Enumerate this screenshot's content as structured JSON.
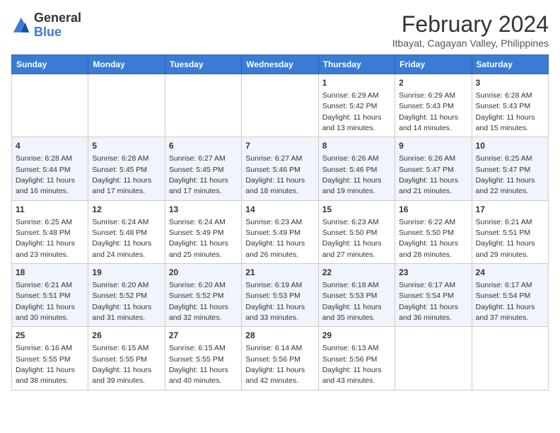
{
  "logo": {
    "general": "General",
    "blue": "Blue"
  },
  "title": "February 2024",
  "location": "Itbayat, Cagayan Valley, Philippines",
  "days_of_week": [
    "Sunday",
    "Monday",
    "Tuesday",
    "Wednesday",
    "Thursday",
    "Friday",
    "Saturday"
  ],
  "weeks": [
    [
      {
        "day": "",
        "sunrise": "",
        "sunset": "",
        "daylight": ""
      },
      {
        "day": "",
        "sunrise": "",
        "sunset": "",
        "daylight": ""
      },
      {
        "day": "",
        "sunrise": "",
        "sunset": "",
        "daylight": ""
      },
      {
        "day": "",
        "sunrise": "",
        "sunset": "",
        "daylight": ""
      },
      {
        "day": "1",
        "sunrise": "Sunrise: 6:29 AM",
        "sunset": "Sunset: 5:42 PM",
        "daylight": "Daylight: 11 hours and 13 minutes."
      },
      {
        "day": "2",
        "sunrise": "Sunrise: 6:29 AM",
        "sunset": "Sunset: 5:43 PM",
        "daylight": "Daylight: 11 hours and 14 minutes."
      },
      {
        "day": "3",
        "sunrise": "Sunrise: 6:28 AM",
        "sunset": "Sunset: 5:43 PM",
        "daylight": "Daylight: 11 hours and 15 minutes."
      }
    ],
    [
      {
        "day": "4",
        "sunrise": "Sunrise: 6:28 AM",
        "sunset": "Sunset: 5:44 PM",
        "daylight": "Daylight: 11 hours and 16 minutes."
      },
      {
        "day": "5",
        "sunrise": "Sunrise: 6:28 AM",
        "sunset": "Sunset: 5:45 PM",
        "daylight": "Daylight: 11 hours and 17 minutes."
      },
      {
        "day": "6",
        "sunrise": "Sunrise: 6:27 AM",
        "sunset": "Sunset: 5:45 PM",
        "daylight": "Daylight: 11 hours and 17 minutes."
      },
      {
        "day": "7",
        "sunrise": "Sunrise: 6:27 AM",
        "sunset": "Sunset: 5:46 PM",
        "daylight": "Daylight: 11 hours and 18 minutes."
      },
      {
        "day": "8",
        "sunrise": "Sunrise: 6:26 AM",
        "sunset": "Sunset: 5:46 PM",
        "daylight": "Daylight: 11 hours and 19 minutes."
      },
      {
        "day": "9",
        "sunrise": "Sunrise: 6:26 AM",
        "sunset": "Sunset: 5:47 PM",
        "daylight": "Daylight: 11 hours and 21 minutes."
      },
      {
        "day": "10",
        "sunrise": "Sunrise: 6:25 AM",
        "sunset": "Sunset: 5:47 PM",
        "daylight": "Daylight: 11 hours and 22 minutes."
      }
    ],
    [
      {
        "day": "11",
        "sunrise": "Sunrise: 6:25 AM",
        "sunset": "Sunset: 5:48 PM",
        "daylight": "Daylight: 11 hours and 23 minutes."
      },
      {
        "day": "12",
        "sunrise": "Sunrise: 6:24 AM",
        "sunset": "Sunset: 5:48 PM",
        "daylight": "Daylight: 11 hours and 24 minutes."
      },
      {
        "day": "13",
        "sunrise": "Sunrise: 6:24 AM",
        "sunset": "Sunset: 5:49 PM",
        "daylight": "Daylight: 11 hours and 25 minutes."
      },
      {
        "day": "14",
        "sunrise": "Sunrise: 6:23 AM",
        "sunset": "Sunset: 5:49 PM",
        "daylight": "Daylight: 11 hours and 26 minutes."
      },
      {
        "day": "15",
        "sunrise": "Sunrise: 6:23 AM",
        "sunset": "Sunset: 5:50 PM",
        "daylight": "Daylight: 11 hours and 27 minutes."
      },
      {
        "day": "16",
        "sunrise": "Sunrise: 6:22 AM",
        "sunset": "Sunset: 5:50 PM",
        "daylight": "Daylight: 11 hours and 28 minutes."
      },
      {
        "day": "17",
        "sunrise": "Sunrise: 6:21 AM",
        "sunset": "Sunset: 5:51 PM",
        "daylight": "Daylight: 11 hours and 29 minutes."
      }
    ],
    [
      {
        "day": "18",
        "sunrise": "Sunrise: 6:21 AM",
        "sunset": "Sunset: 5:51 PM",
        "daylight": "Daylight: 11 hours and 30 minutes."
      },
      {
        "day": "19",
        "sunrise": "Sunrise: 6:20 AM",
        "sunset": "Sunset: 5:52 PM",
        "daylight": "Daylight: 11 hours and 31 minutes."
      },
      {
        "day": "20",
        "sunrise": "Sunrise: 6:20 AM",
        "sunset": "Sunset: 5:52 PM",
        "daylight": "Daylight: 11 hours and 32 minutes."
      },
      {
        "day": "21",
        "sunrise": "Sunrise: 6:19 AM",
        "sunset": "Sunset: 5:53 PM",
        "daylight": "Daylight: 11 hours and 33 minutes."
      },
      {
        "day": "22",
        "sunrise": "Sunrise: 6:18 AM",
        "sunset": "Sunset: 5:53 PM",
        "daylight": "Daylight: 11 hours and 35 minutes."
      },
      {
        "day": "23",
        "sunrise": "Sunrise: 6:17 AM",
        "sunset": "Sunset: 5:54 PM",
        "daylight": "Daylight: 11 hours and 36 minutes."
      },
      {
        "day": "24",
        "sunrise": "Sunrise: 6:17 AM",
        "sunset": "Sunset: 5:54 PM",
        "daylight": "Daylight: 11 hours and 37 minutes."
      }
    ],
    [
      {
        "day": "25",
        "sunrise": "Sunrise: 6:16 AM",
        "sunset": "Sunset: 5:55 PM",
        "daylight": "Daylight: 11 hours and 38 minutes."
      },
      {
        "day": "26",
        "sunrise": "Sunrise: 6:15 AM",
        "sunset": "Sunset: 5:55 PM",
        "daylight": "Daylight: 11 hours and 39 minutes."
      },
      {
        "day": "27",
        "sunrise": "Sunrise: 6:15 AM",
        "sunset": "Sunset: 5:55 PM",
        "daylight": "Daylight: 11 hours and 40 minutes."
      },
      {
        "day": "28",
        "sunrise": "Sunrise: 6:14 AM",
        "sunset": "Sunset: 5:56 PM",
        "daylight": "Daylight: 11 hours and 42 minutes."
      },
      {
        "day": "29",
        "sunrise": "Sunrise: 6:13 AM",
        "sunset": "Sunset: 5:56 PM",
        "daylight": "Daylight: 11 hours and 43 minutes."
      },
      {
        "day": "",
        "sunrise": "",
        "sunset": "",
        "daylight": ""
      },
      {
        "day": "",
        "sunrise": "",
        "sunset": "",
        "daylight": ""
      }
    ]
  ]
}
